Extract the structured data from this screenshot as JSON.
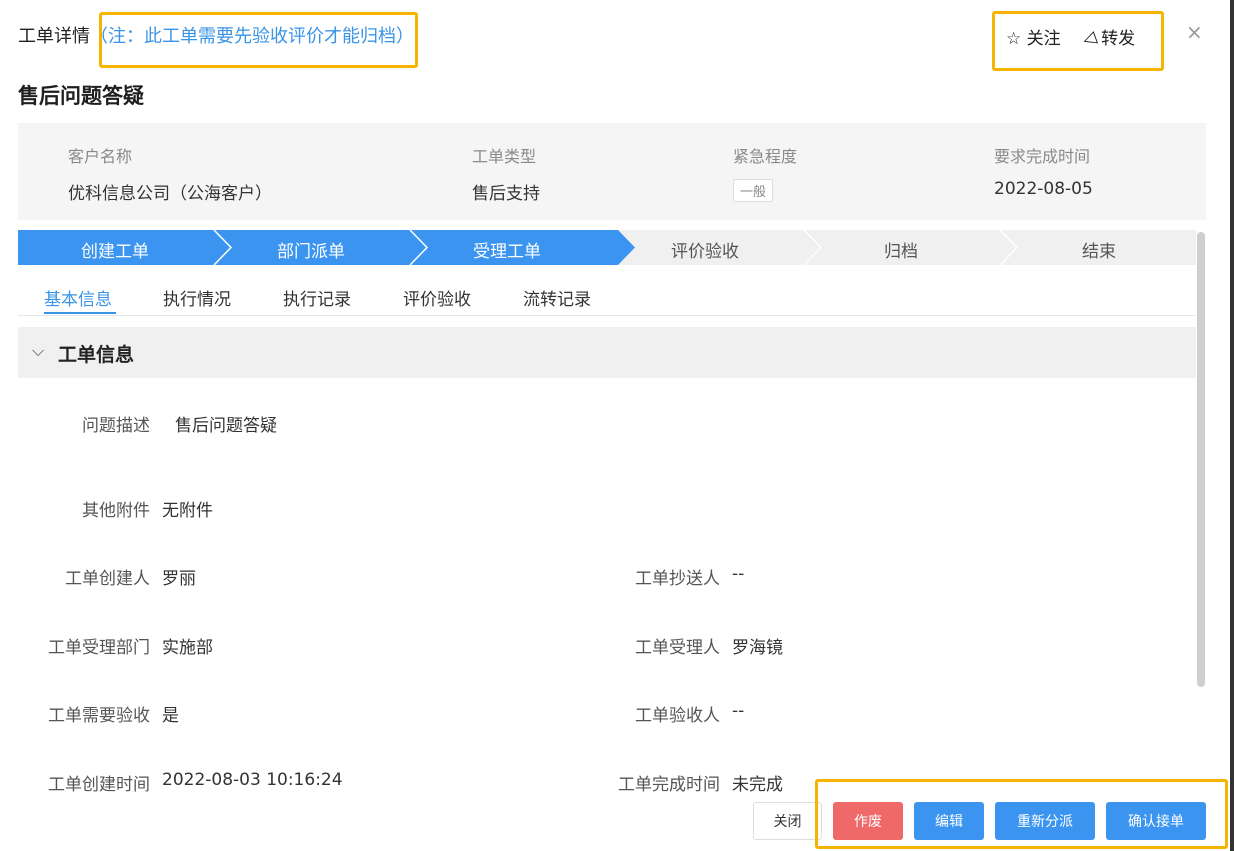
{
  "header": {
    "title": "工单详情",
    "note": "（注：此工单需要先验收评价才能归档）",
    "follow_label": "关注",
    "forward_label": "转发",
    "close_symbol": "×"
  },
  "title": "售后问题答疑",
  "summary": {
    "customer_label": "客户名称",
    "customer_value": "优科信息公司（公海客户）",
    "type_label": "工单类型",
    "type_value": "售后支持",
    "urgency_label": "紧急程度",
    "urgency_value": "一般",
    "due_label": "要求完成时间",
    "due_value": "2022-08-05"
  },
  "steps": [
    {
      "label": "创建工单",
      "done": true
    },
    {
      "label": "部门派单",
      "done": true
    },
    {
      "label": "受理工单",
      "done": true
    },
    {
      "label": "评价验收",
      "done": false
    },
    {
      "label": "归档",
      "done": false
    },
    {
      "label": "结束",
      "done": false
    }
  ],
  "tabs": [
    "基本信息",
    "执行情况",
    "执行记录",
    "评价验收",
    "流转记录"
  ],
  "section": {
    "title": "工单信息"
  },
  "fields": {
    "desc_label": "问题描述",
    "desc_value": "售后问题答疑",
    "attach_label": "其他附件",
    "attach_value": "无附件",
    "creator_label": "工单创建人",
    "creator_value": "罗丽",
    "cc_label": "工单抄送人",
    "cc_value": "--",
    "dept_label": "工单受理部门",
    "dept_value": "实施部",
    "handler_label": "工单受理人",
    "handler_value": "罗海镜",
    "need_check_label": "工单需要验收",
    "need_check_value": "是",
    "checker_label": "工单验收人",
    "checker_value": "--",
    "created_time_label": "工单创建时间",
    "created_time_value": "2022-08-03 10:16:24",
    "finish_time_label": "工单完成时间",
    "finish_time_value": "未完成"
  },
  "footer": {
    "close": "关闭",
    "void": "作废",
    "edit": "编辑",
    "reassign": "重新分派",
    "accept": "确认接单"
  },
  "colors": {
    "accent": "#3a94f0",
    "highlight": "#f5b400",
    "danger": "#f06969"
  },
  "icons": {
    "follow": "star-outline-icon",
    "forward": "send-icon",
    "collapse": "chevron-down-icon"
  }
}
